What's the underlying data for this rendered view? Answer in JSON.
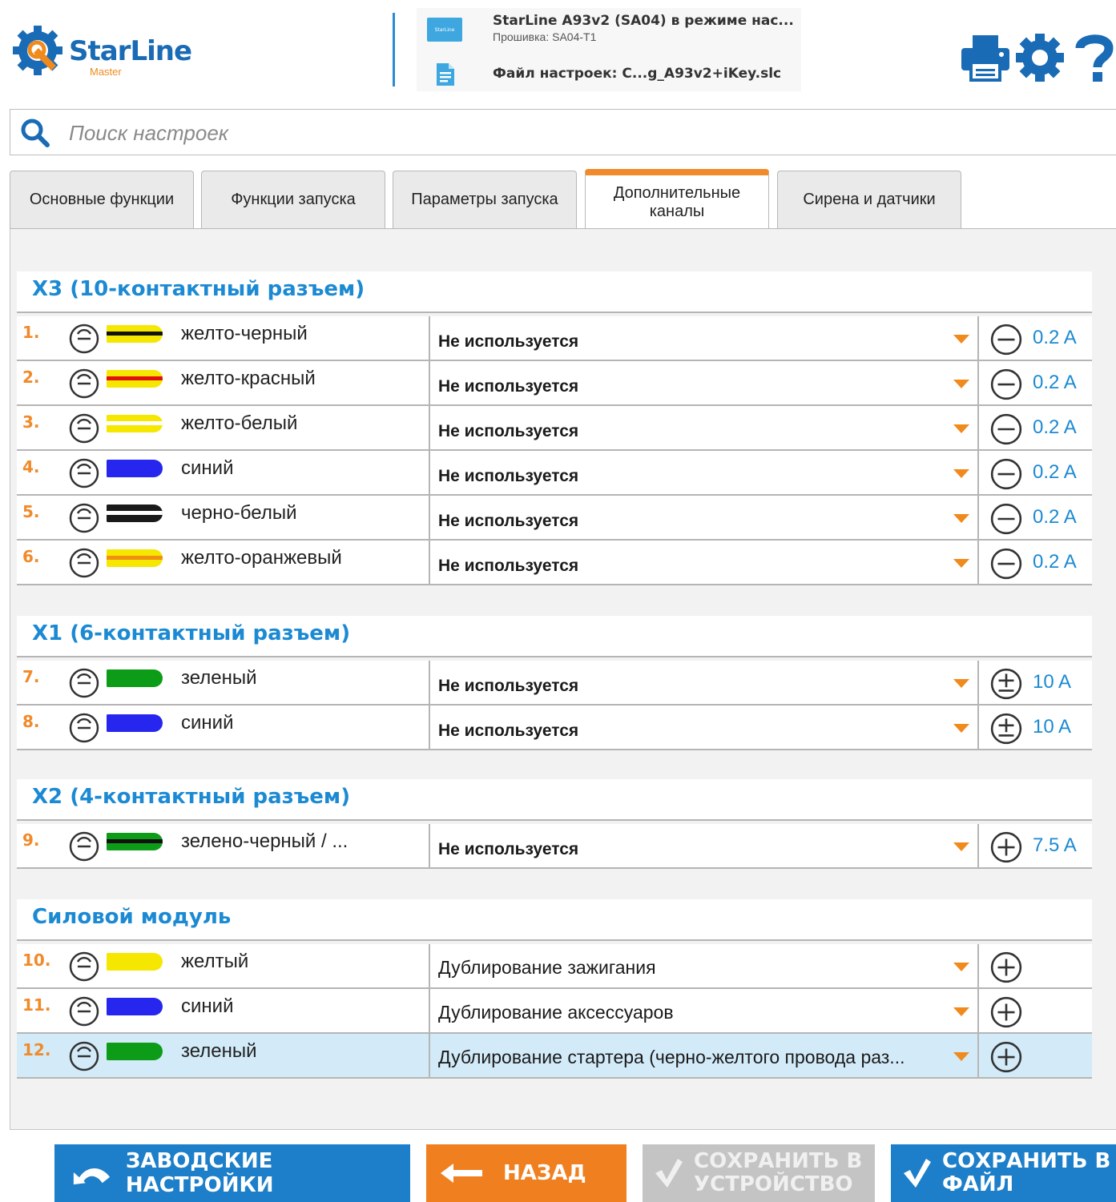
{
  "header": {
    "logo_text": "StarLine",
    "logo_sub": "Master",
    "device_chip_text": "StarLine",
    "device_title": "StarLine A93v2 (SA04) в режиме нас...",
    "firmware": "Прошивка: SA04-T1",
    "settings_file": "Файл настроек: C...g_A93v2+iKey.slc",
    "icons": [
      "printer-icon",
      "gear-icon",
      "help-icon"
    ],
    "accent_color": "#1c8ad3"
  },
  "search": {
    "placeholder": "Поиск настроек"
  },
  "tabs": [
    {
      "label": "Основные функции",
      "active": false
    },
    {
      "label": "Функции запуска",
      "active": false
    },
    {
      "label": "Параметры запуска",
      "active": false
    },
    {
      "label": "Дополнительные каналы",
      "active": true
    },
    {
      "label": "Сирена и датчики",
      "active": false
    }
  ],
  "sections": [
    {
      "title": "X3 (10-контактный разъем)"
    },
    {
      "title": "X1 (6-контактный разъем)"
    },
    {
      "title": "X2 (4-контактный разъем)"
    },
    {
      "title": "Силовой модуль"
    }
  ],
  "rows": [
    {
      "num": "1.",
      "wire": "желто-черный",
      "base": "#f5e700",
      "stripe": "#111111",
      "value": "Не используется",
      "polarity": "minus",
      "amp": "0.2 A"
    },
    {
      "num": "2.",
      "wire": "желто-красный",
      "base": "#f5e700",
      "stripe": "#e01010",
      "value": "Не используется",
      "polarity": "minus",
      "amp": "0.2 A"
    },
    {
      "num": "3.",
      "wire": "желто-белый",
      "base": "#f5e700",
      "stripe": "#ffffff",
      "value": "Не используется",
      "polarity": "minus",
      "amp": "0.2 A"
    },
    {
      "num": "4.",
      "wire": "синий",
      "base": "#2626ee",
      "stripe": "",
      "value": "Не используется",
      "polarity": "minus",
      "amp": "0.2 A"
    },
    {
      "num": "5.",
      "wire": "черно-белый",
      "base": "#1a1a1a",
      "stripe": "#ffffff",
      "value": "Не используется",
      "polarity": "minus",
      "amp": "0.2 A"
    },
    {
      "num": "6.",
      "wire": "желто-оранжевый",
      "base": "#f5e700",
      "stripe": "#f09010",
      "value": "Не используется",
      "polarity": "minus",
      "amp": "0.2 A"
    },
    {
      "num": "7.",
      "wire": "зеленый",
      "base": "#0c9c18",
      "stripe": "",
      "value": "Не используется",
      "polarity": "plusminus",
      "amp": "10 A"
    },
    {
      "num": "8.",
      "wire": "синий",
      "base": "#2626ee",
      "stripe": "",
      "value": "Не используется",
      "polarity": "plusminus",
      "amp": "10 A"
    },
    {
      "num": "9.",
      "wire": "зелено-черный / ...",
      "base": "#0c9c18",
      "stripe": "#111111",
      "value": "Не используется",
      "polarity": "plus",
      "amp": "7.5 A"
    },
    {
      "num": "10.",
      "wire": "желтый",
      "base": "#f5e700",
      "stripe": "",
      "value": "Дублирование зажигания",
      "polarity": "plus",
      "amp": ""
    },
    {
      "num": "11.",
      "wire": "синий",
      "base": "#2626ee",
      "stripe": "",
      "value": "Дублирование аксессуаров",
      "polarity": "plus",
      "amp": ""
    },
    {
      "num": "12.",
      "wire": "зеленый",
      "base": "#0c9c18",
      "stripe": "",
      "value": "Дублирование стартера (черно-желтого провода раз...",
      "polarity": "plus",
      "amp": ""
    }
  ],
  "buttons": {
    "factory": "ЗАВОДСКИЕ НАСТРОЙКИ",
    "back": "НАЗАД",
    "save_device_1": "СОХРАНИТЬ В",
    "save_device_2": "УСТРОЙСТВО",
    "save_file_1": "СОХРАНИТЬ В",
    "save_file_2": "ФАЙЛ"
  }
}
